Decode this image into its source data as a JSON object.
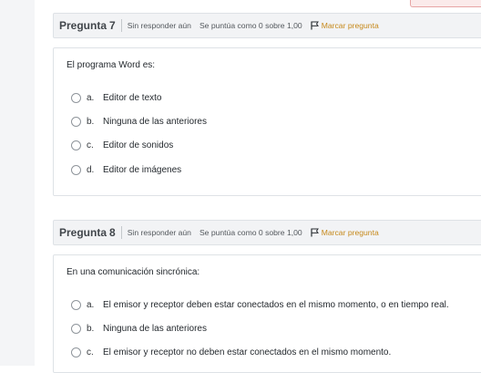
{
  "questions": [
    {
      "label": "Pregunta",
      "number": "7",
      "state": "Sin responder aún",
      "grade": "Se puntúa como 0 sobre 1,00",
      "flag_label": "Marcar pregunta",
      "prompt": "El programa Word es:",
      "answers": [
        {
          "letter": "a.",
          "text": "Editor de texto"
        },
        {
          "letter": "b.",
          "text": "Ninguna de las anteriores"
        },
        {
          "letter": "c.",
          "text": "Editor de sonidos"
        },
        {
          "letter": "d.",
          "text": "Editor de imágenes"
        }
      ]
    },
    {
      "label": "Pregunta",
      "number": "8",
      "state": "Sin responder aún",
      "grade": "Se puntúa como 0 sobre 1,00",
      "flag_label": "Marcar pregunta",
      "prompt": "En una comunicación sincrónica:",
      "answers": [
        {
          "letter": "a.",
          "text": "El emisor y receptor deben estar conectados en el mismo momento, o en tiempo real."
        },
        {
          "letter": "b.",
          "text": "Ninguna de las anteriores"
        },
        {
          "letter": "c.",
          "text": "El emisor y receptor no deben estar conectados en el mismo momento."
        }
      ]
    }
  ],
  "colors": {
    "flag": "#c6891b",
    "info_bar_bg": "#f2f3f5",
    "border": "#dee2e6",
    "gutter": "#f4f5f7"
  },
  "icons": {
    "flag": "flag-icon",
    "radio": "radio-button"
  }
}
